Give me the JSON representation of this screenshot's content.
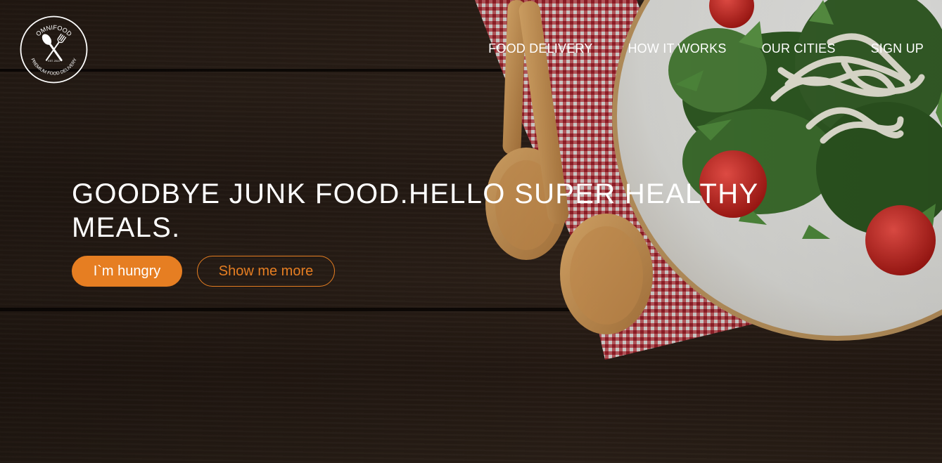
{
  "logo": {
    "top_text": "OMNIFOOD",
    "est_text": "EST. 2015",
    "bottom_text": "PREMIUM FOOD DELIVERY"
  },
  "nav": {
    "items": [
      {
        "label": "FOOD DELIVERY"
      },
      {
        "label": "HOW IT WORKS"
      },
      {
        "label": "OUR CITIES"
      },
      {
        "label": "SIGN UP"
      }
    ]
  },
  "hero": {
    "headline": "GOODBYE JUNK FOOD.HELLO SUPER HEALTHY MEALS.",
    "primary_button": "I`m hungry",
    "secondary_button": "Show me more"
  },
  "colors": {
    "accent": "#e67e22",
    "text": "#ffffff",
    "background": "#2a1e16"
  }
}
